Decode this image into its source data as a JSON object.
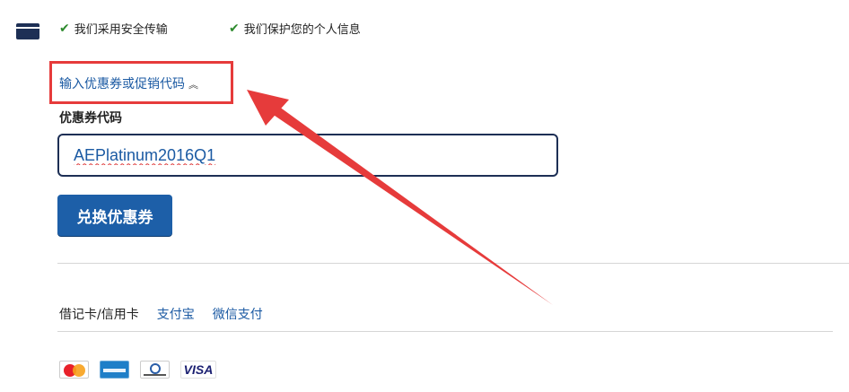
{
  "trust": {
    "item1": "我们采用安全传输",
    "item2": "我们保护您的个人信息"
  },
  "promo": {
    "toggle_label": "输入优惠券或促销代码",
    "toggle_chevron": "⌃",
    "coupon_label": "优惠券代码",
    "coupon_value": "AEPlatinum2016Q1",
    "redeem_label": "兑换优惠券"
  },
  "payment": {
    "tabs": [
      {
        "label": "借记卡/信用卡",
        "active": true
      },
      {
        "label": "支付宝",
        "active": false
      },
      {
        "label": "微信支付",
        "active": false
      }
    ],
    "logos": [
      "mastercard-logo",
      "amex-logo",
      "diners-logo",
      "visa-logo"
    ],
    "visa_text": "VISA"
  },
  "colors": {
    "annotation": "#e63b3b",
    "link": "#1b5aa3",
    "button": "#1d5fa8",
    "input_border": "#1d2f55",
    "check": "#2d8a2d"
  }
}
